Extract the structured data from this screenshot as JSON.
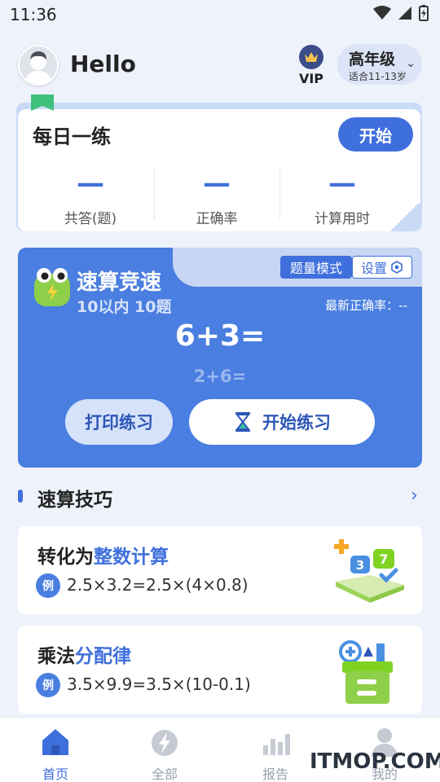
{
  "status_bar": {
    "time": "11:36"
  },
  "header": {
    "greeting": "Hello",
    "vip_label": "VIP",
    "grade_main": "高年级",
    "grade_sub": "适合11-13岁"
  },
  "daily": {
    "title": "每日一练",
    "start_label": "开始",
    "stats": [
      {
        "value": "—",
        "label": "共答(题)"
      },
      {
        "value": "—",
        "label": "正确率"
      },
      {
        "value": "—",
        "label": "计算用时"
      }
    ]
  },
  "speed": {
    "mode_label": "题量模式",
    "settings_label": "设置",
    "title": "速算竞速",
    "subtitle": "10以内 10题",
    "accuracy_text": "最新正确率：--",
    "current_question": "6+3=",
    "next_question": "2+6=",
    "print_label": "打印练习",
    "practice_label": "开始练习"
  },
  "tips_section": {
    "title": "速算技巧",
    "items": [
      {
        "title_prefix": "转化为",
        "title_highlight": "整数计算",
        "example_badge": "例",
        "example": "2.5×3.2=2.5×(4×0.8)"
      },
      {
        "title_prefix": "乘法",
        "title_highlight": "分配律",
        "example_badge": "例",
        "example": "3.5×9.9=3.5×(10-0.1)"
      }
    ]
  },
  "nav": {
    "items": [
      {
        "label": "首页",
        "icon": "home-icon",
        "active": true
      },
      {
        "label": "全部",
        "icon": "lightning-icon",
        "active": false
      },
      {
        "label": "报告",
        "icon": "bar-chart-icon",
        "active": false
      },
      {
        "label": "我的",
        "icon": "person-icon",
        "active": false
      }
    ]
  },
  "watermark": "ITMOP.COM",
  "colors": {
    "accent": "#3f6fdc",
    "card_blue": "#4a7ee0",
    "background": "#eef2fb",
    "green": "#3fc17e"
  }
}
